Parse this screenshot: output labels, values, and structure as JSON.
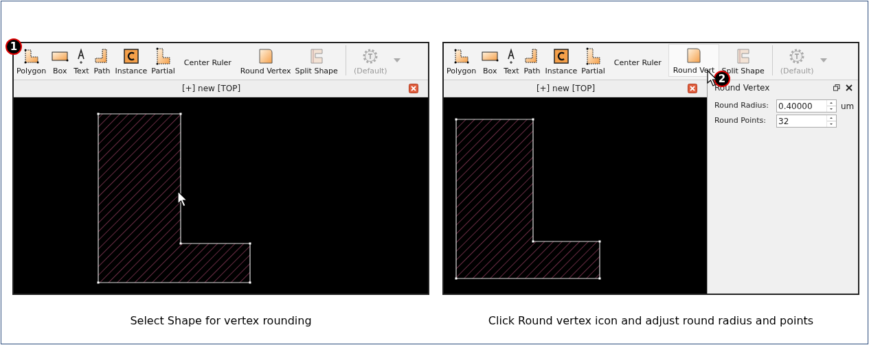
{
  "panels": [
    {
      "badge": "1",
      "toolbar": [
        {
          "label": "Polygon",
          "kind": "polygon",
          "selected": false,
          "disabled": false
        },
        {
          "label": "Box",
          "kind": "box",
          "selected": false,
          "disabled": false
        },
        {
          "label": "Text",
          "kind": "text",
          "selected": false,
          "disabled": false
        },
        {
          "label": "Path",
          "kind": "path",
          "selected": false,
          "disabled": false
        },
        {
          "label": "Instance",
          "kind": "instance",
          "selected": false,
          "disabled": false
        },
        {
          "label": "Partial",
          "kind": "partial",
          "selected": false,
          "disabled": false
        },
        {
          "label": "Center Ruler",
          "kind": "plain",
          "selected": false,
          "disabled": false
        },
        {
          "label": "Round Vertex",
          "kind": "round",
          "selected": false,
          "disabled": false
        },
        {
          "label": "Split Shape",
          "kind": "split",
          "selected": false,
          "disabled": false
        },
        {
          "label": "(Default)",
          "kind": "gear",
          "selected": false,
          "disabled": true
        }
      ],
      "tab": "[+] new [TOP]",
      "caption": "Select Shape for vertex  rounding"
    },
    {
      "badge": "2",
      "toolbar": [
        {
          "label": "Polygon",
          "kind": "polygon",
          "selected": false,
          "disabled": false
        },
        {
          "label": "Box",
          "kind": "box",
          "selected": false,
          "disabled": false
        },
        {
          "label": "Text",
          "kind": "text",
          "selected": false,
          "disabled": false
        },
        {
          "label": "Path",
          "kind": "path",
          "selected": false,
          "disabled": false
        },
        {
          "label": "Instance",
          "kind": "instance",
          "selected": false,
          "disabled": false
        },
        {
          "label": "Partial",
          "kind": "partial",
          "selected": false,
          "disabled": false
        },
        {
          "label": "Center Ruler",
          "kind": "plain",
          "selected": false,
          "disabled": false
        },
        {
          "label": "Round Vert",
          "kind": "round",
          "selected": true,
          "disabled": false
        },
        {
          "label": "Split Shape",
          "kind": "split",
          "selected": false,
          "disabled": false
        },
        {
          "label": "(Default)",
          "kind": "gear",
          "selected": false,
          "disabled": true
        }
      ],
      "tab": "[+] new [TOP]",
      "caption": "Click Round vertex icon and adjust round radius and points",
      "side_panel": {
        "title": "Round Vertex",
        "fields": [
          {
            "label": "Round Radius:",
            "value": "0.40000",
            "unit": "um"
          },
          {
            "label": "Round Points:",
            "value": "32"
          }
        ]
      }
    }
  ]
}
